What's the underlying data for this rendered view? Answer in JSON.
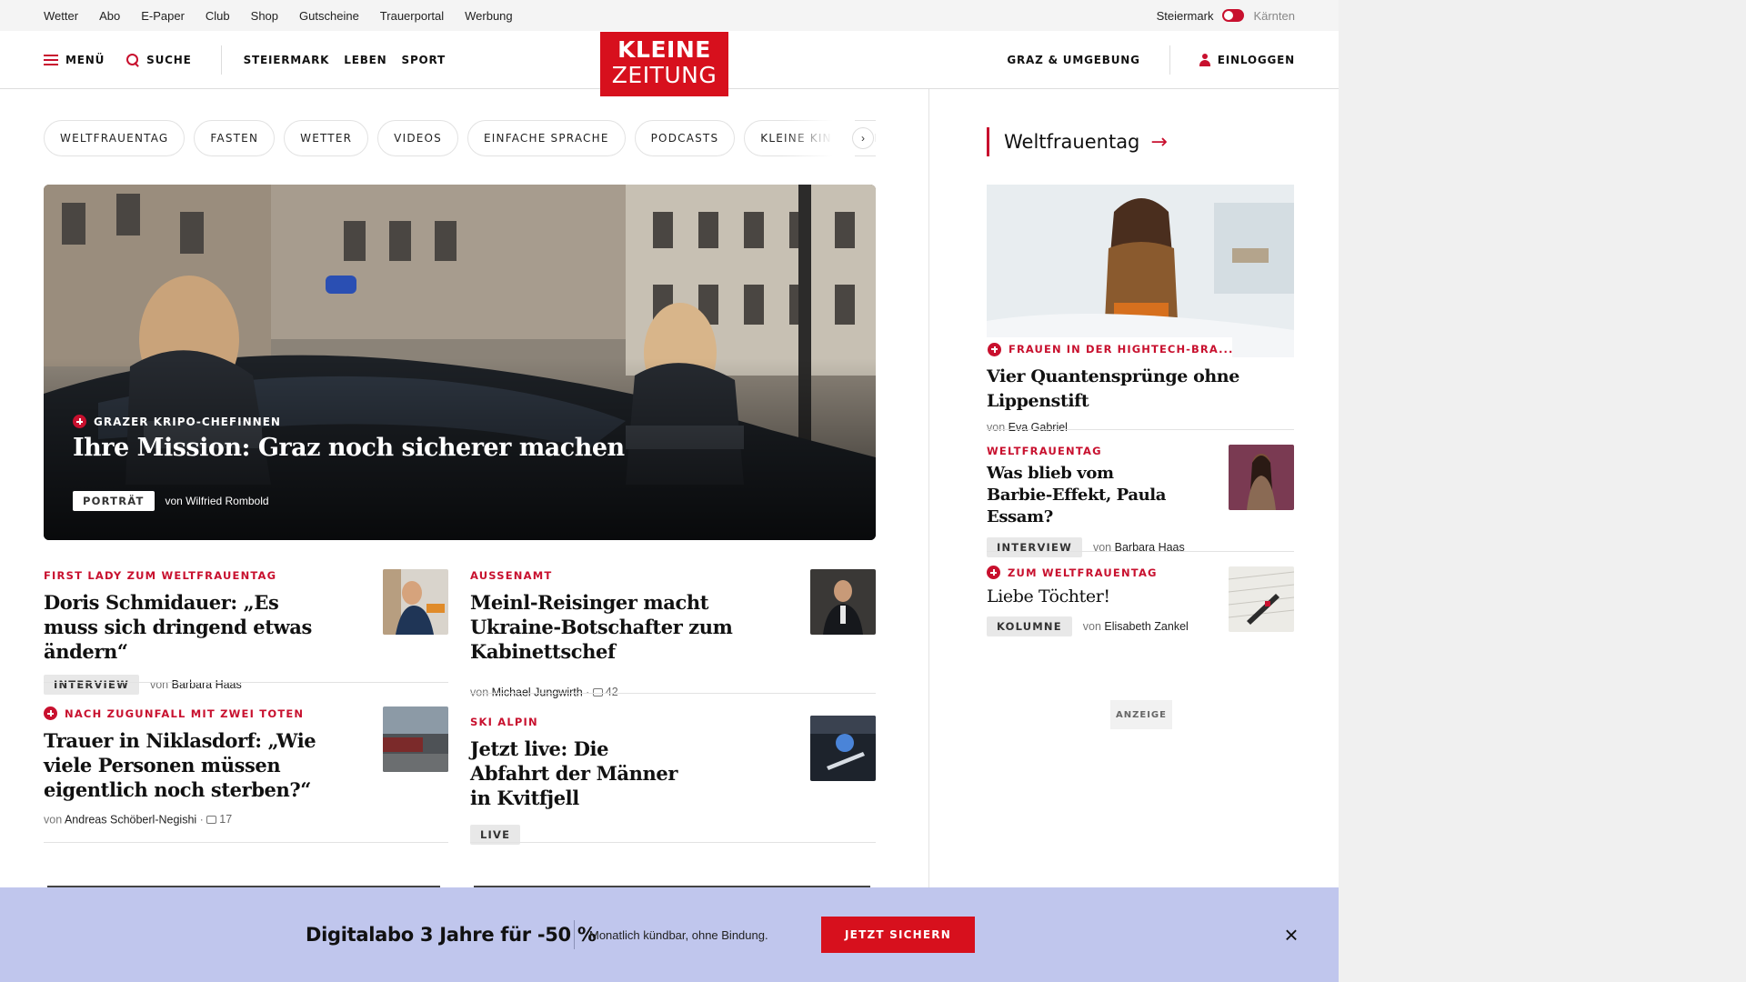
{
  "utility": {
    "links": [
      "Wetter",
      "Abo",
      "E-Paper",
      "Club",
      "Shop",
      "Gutscheine",
      "Trauerportal",
      "Werbung"
    ],
    "region_active": "Steiermark",
    "region_inactive": "Kärnten"
  },
  "header": {
    "menu_label": "MENÜ",
    "search_label": "SUCHE",
    "nav": [
      "STEIERMARK",
      "LEBEN",
      "SPORT"
    ],
    "logo_line1": "KLEINE",
    "logo_line2": "ZEITUNG",
    "region_link": "GRAZ & UMGEBUNG",
    "login_label": "EINLOGGEN"
  },
  "chips": [
    "WELTFRAUENTAG",
    "FASTEN",
    "WETTER",
    "VIDEOS",
    "EINFACHE SPRACHE",
    "PODCASTS",
    "KLEINE KINDERZEITUNG"
  ],
  "hero": {
    "kicker": "GRAZER KRIPO-CHEFINNEN",
    "headline": "Ihre Mission: Graz noch sicherer machen",
    "badge": "PORTRÄT",
    "author": "von Wilfried Rombold"
  },
  "articles": {
    "a1": {
      "kicker": "FIRST LADY ZUM WELTFRAUENTAG",
      "title": "Doris Schmidauer: „Es muss sich dringend etwas ändern“",
      "badge": "INTERVIEW",
      "by": "von",
      "author": "Barbara Haas"
    },
    "a2": {
      "kicker": "AUSSENAMT",
      "title": "Meinl-Reisinger macht Ukraine-Botschafter zum Kabinettschef",
      "by": "von",
      "author": "Michael Jungwirth",
      "comments": "42"
    },
    "a3": {
      "kicker": "NACH ZUGUNFALL MIT ZWEI TOTEN",
      "title": "Trauer in Niklasdorf: „Wie viele Personen müssen eigentlich noch sterben?“",
      "by": "von",
      "author": "Andreas Schöberl-Negishi",
      "comments": "17"
    },
    "a4": {
      "kicker": "SKI ALPIN",
      "title": "Jetzt live: Die Abfahrt der Männer in Kvitfjell",
      "badge": "LIVE"
    }
  },
  "sidebar": {
    "heading": "Weltfrauentag",
    "s1": {
      "kicker": "FRAUEN IN DER HIGHTECH-BRA...",
      "title": "Vier Quantensprünge ohne Lippenstift",
      "by": "von",
      "author": "Eva Gabriel"
    },
    "s2": {
      "kicker": "WELTFRAUENTAG",
      "title": "Was blieb vom Barbie-Effekt, Paula Essam?",
      "badge": "INTERVIEW",
      "by": "von",
      "author": "Barbara Haas"
    },
    "s3": {
      "kicker": "ZUM WELTFRAUENTAG",
      "title": "Liebe Töchter!",
      "badge": "KOLUMNE",
      "by": "von",
      "author": "Elisabeth Zankel"
    },
    "ad_label": "ANZEIGE"
  },
  "promo": {
    "title": "Digitalabo 3 Jahre für -50 %",
    "subtitle": "Monatlich kündbar, ohne Bindung.",
    "button": "JETZT SICHERN"
  },
  "colors": {
    "brand_red": "#d7101d",
    "kicker_red": "#c8102e",
    "promo_bg": "#c0c6ed"
  }
}
